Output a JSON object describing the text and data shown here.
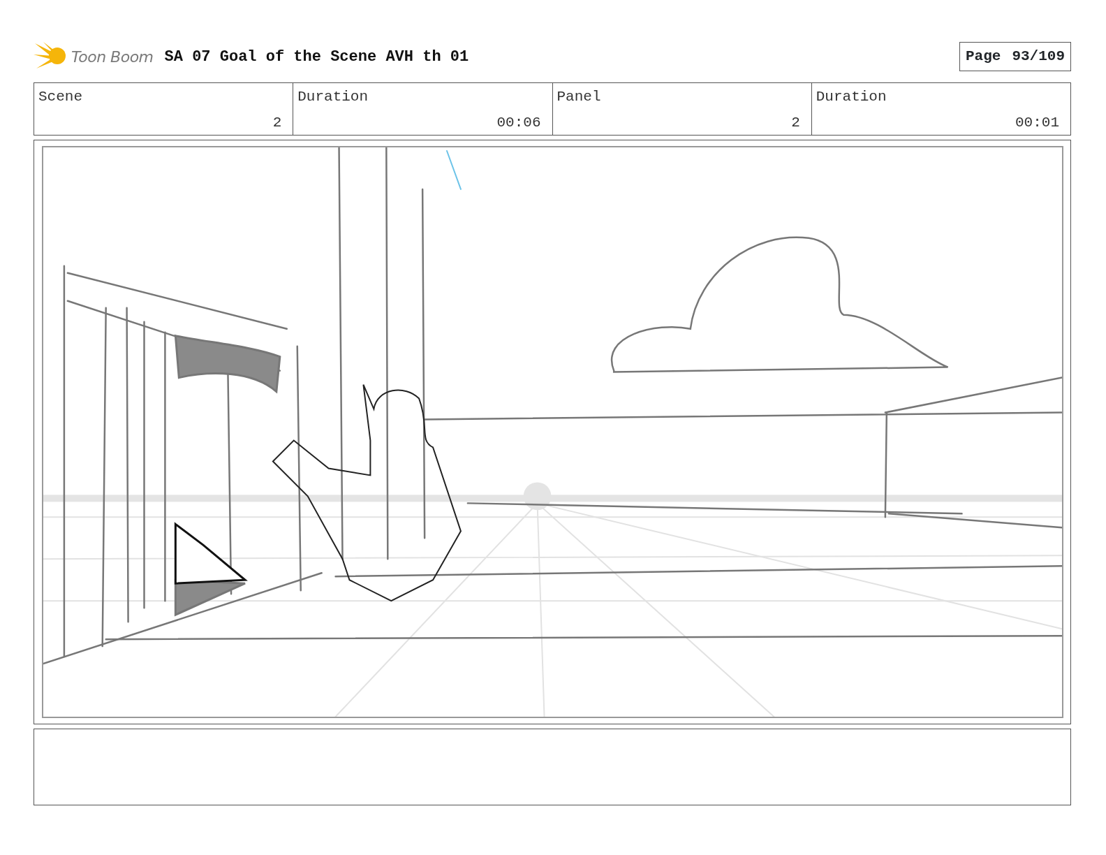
{
  "header": {
    "logo_text": "Toon Boom",
    "title": "SA 07 Goal of the Scene AVH th 01",
    "page_label": "Page",
    "page_number": "93/109"
  },
  "info": [
    {
      "label": "Scene",
      "value": "2"
    },
    {
      "label": "Duration",
      "value": "00:06"
    },
    {
      "label": "Panel",
      "value": "2"
    },
    {
      "label": "Duration",
      "value": "00:01"
    }
  ]
}
